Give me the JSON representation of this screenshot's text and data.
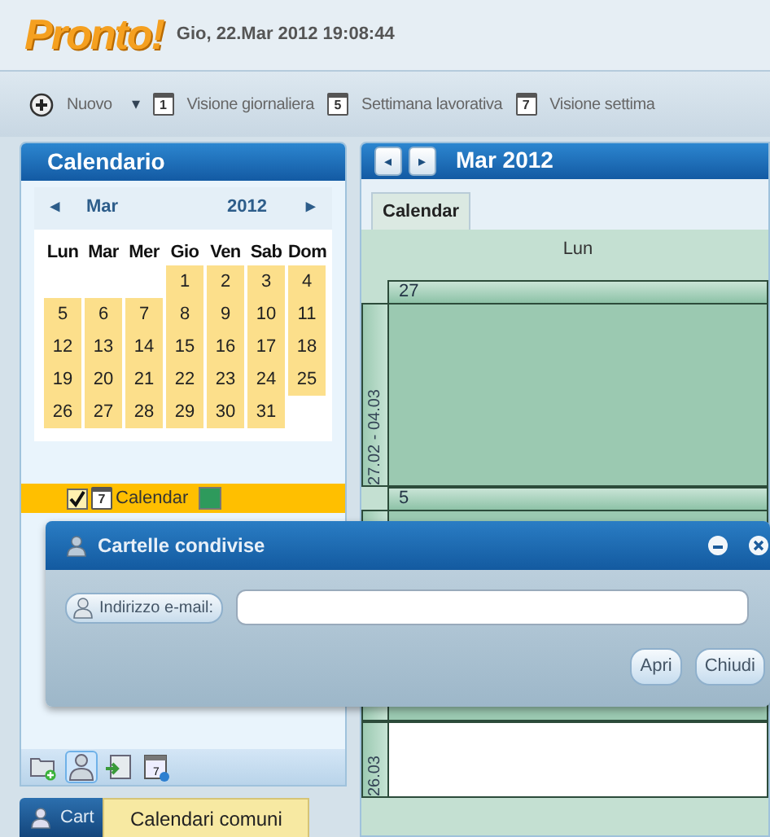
{
  "header": {
    "logo": "Pronto!",
    "datetime": "Gio, 22.Mar 2012 19:08:44"
  },
  "toolbar": [
    {
      "kind": "new",
      "label": "Nuovo"
    },
    {
      "kind": "caret",
      "label": "▾"
    },
    {
      "kind": "view",
      "digit": "1",
      "label": "Visione giornaliera"
    },
    {
      "kind": "view",
      "digit": "5",
      "label": "Settimana lavorativa"
    },
    {
      "kind": "view",
      "digit": "7",
      "label": "Visione settima"
    }
  ],
  "sidebar": {
    "title": "Calendario",
    "mini_calendar": {
      "prev": "◂",
      "month": "Mar",
      "year": "2012",
      "next": "▸",
      "weekdays": [
        "Lun",
        "Mar",
        "Mer",
        "Gio",
        "Ven",
        "Sab",
        "Dom"
      ],
      "weeks": [
        [
          {
            "kind": "blank"
          },
          {
            "kind": "blank"
          },
          {
            "kind": "blank"
          },
          {
            "kind": "day",
            "day": "1"
          },
          {
            "kind": "day",
            "day": "2"
          },
          {
            "kind": "day",
            "day": "3"
          },
          {
            "kind": "day",
            "day": "4"
          }
        ],
        [
          {
            "kind": "day",
            "day": "5"
          },
          {
            "kind": "day",
            "day": "6"
          },
          {
            "kind": "day",
            "day": "7"
          },
          {
            "kind": "day",
            "day": "8"
          },
          {
            "kind": "day",
            "day": "9"
          },
          {
            "kind": "day",
            "day": "10"
          },
          {
            "kind": "day",
            "day": "11"
          }
        ],
        [
          {
            "kind": "day",
            "day": "12"
          },
          {
            "kind": "day",
            "day": "13"
          },
          {
            "kind": "day",
            "day": "14"
          },
          {
            "kind": "day",
            "day": "15"
          },
          {
            "kind": "day",
            "day": "16"
          },
          {
            "kind": "day",
            "day": "17"
          },
          {
            "kind": "day",
            "day": "18"
          }
        ],
        [
          {
            "kind": "day",
            "day": "19"
          },
          {
            "kind": "day",
            "day": "20"
          },
          {
            "kind": "day",
            "day": "21"
          },
          {
            "kind": "day",
            "day": "22"
          },
          {
            "kind": "day",
            "day": "23"
          },
          {
            "kind": "day",
            "day": "24"
          },
          {
            "kind": "day",
            "day": "25"
          }
        ],
        [
          {
            "kind": "day",
            "day": "26"
          },
          {
            "kind": "day",
            "day": "27"
          },
          {
            "kind": "day",
            "day": "28"
          },
          {
            "kind": "day",
            "day": "29"
          },
          {
            "kind": "day",
            "day": "30"
          },
          {
            "kind": "day",
            "day": "31"
          },
          {
            "kind": "blank"
          }
        ]
      ]
    },
    "calendars": [
      {
        "label": "Calendar",
        "checked": true,
        "icon_digit": "7",
        "color": "#2e9a5c"
      }
    ],
    "footer_icons": [
      {
        "kind": "folder-add",
        "selected": false
      },
      {
        "kind": "user",
        "selected": true
      },
      {
        "kind": "import",
        "selected": false
      },
      {
        "kind": "calendar",
        "digit": "7",
        "selected": false
      }
    ]
  },
  "taskbar": {
    "button": "Cart",
    "tooltip": "Calendari comuni"
  },
  "main": {
    "prev": "◂",
    "next": "▸",
    "title": "Mar 2012",
    "tabs": [
      {
        "label": "Calendar",
        "selected": true
      }
    ],
    "day_header": "Lun",
    "weeks": [
      {
        "range": "27.02 - 04.03",
        "day": "27",
        "shaded": true
      },
      {
        "day": "5",
        "shaded": true
      },
      {
        "range": "26.03",
        "shaded": false
      }
    ]
  },
  "dialog": {
    "title": "Cartelle condivise",
    "field_label": "Indirizzo e-mail:",
    "buttons": [
      "Apri",
      "Chiudi"
    ]
  }
}
